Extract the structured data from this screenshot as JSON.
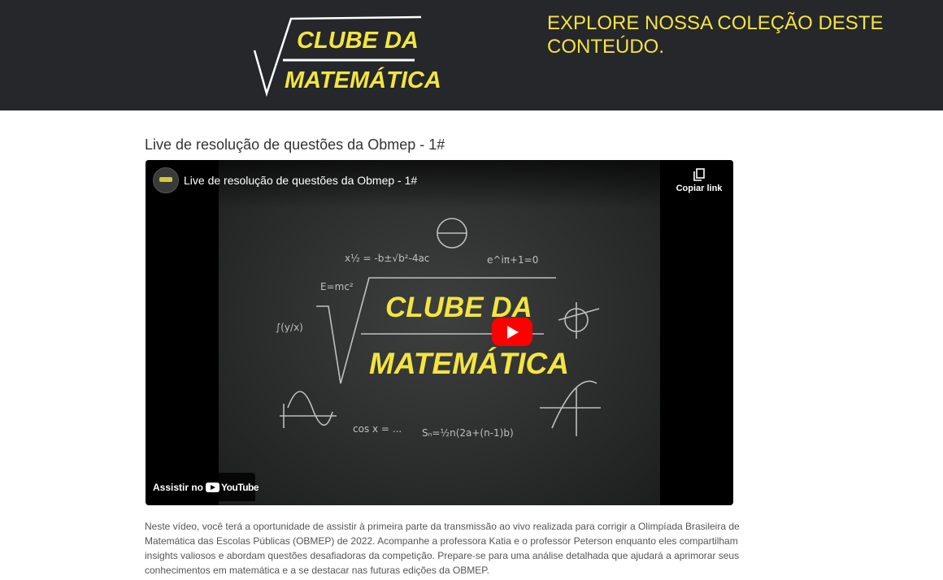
{
  "header": {
    "logo_line1": "CLUBE DA",
    "logo_line2": "MATEMÁTICA",
    "tagline": "EXPLORE NOSSA COLEÇÃO DESTE CONTEÚDO."
  },
  "post": {
    "title": "Live de resolução de questões da Obmep - 1#",
    "description": "Neste vídeo, você terá a oportunidade de assistir à primeira parte da transmissão ao vivo realizada para corrigir a Olimpíada Brasileira de Matemática das Escolas Públicas (OBMEP) de 2022. Acompanhe a professora Katia e o professor Peterson enquanto eles compartilham insights valiosos e abordam questões desafiadoras da competição. Prepare-se para uma análise detalhada que ajudará a aprimorar seus conhecimentos em matemática e a se destacar nas futuras edições da OBMEP."
  },
  "video": {
    "title": "Live de resolução de questões da Obmep - 1#",
    "copy_link_label": "Copiar link",
    "watch_on_label": "Assistir no",
    "youtube_label": "YouTube",
    "thumbnail_line1": "CLUBE DA",
    "thumbnail_line2": "MATEMÁTICA"
  },
  "colors": {
    "header_bg": "#25272b",
    "accent_yellow": "#f5e343",
    "play_red": "#ff0000"
  },
  "icons": [
    "copy-icon",
    "play-icon",
    "youtube-icon",
    "channel-avatar"
  ]
}
